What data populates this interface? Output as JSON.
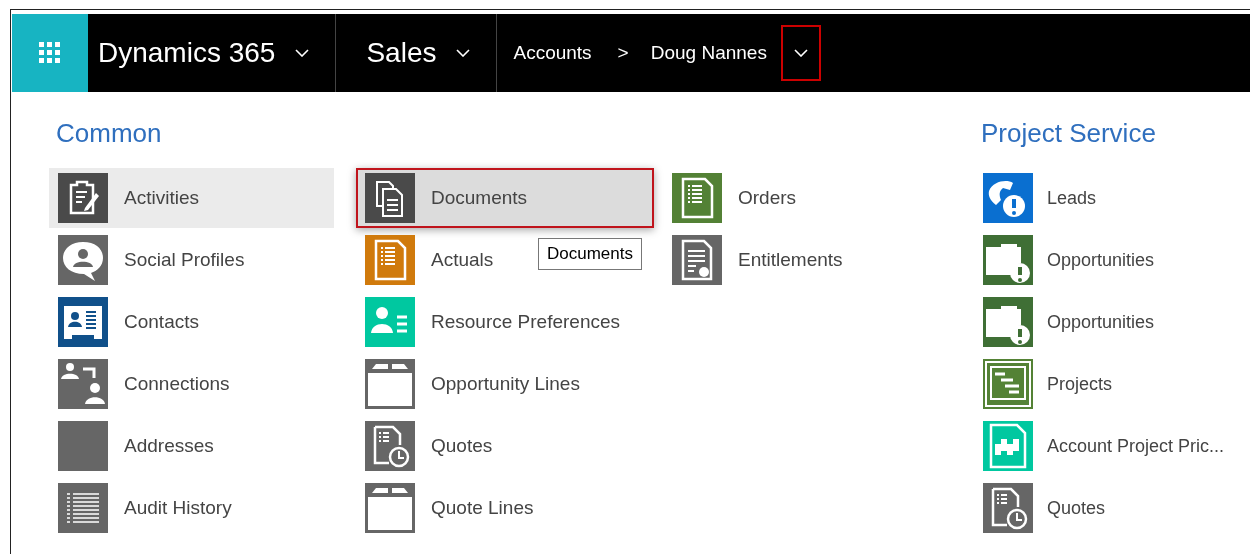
{
  "top_bar": {
    "app_title": "Dynamics 365",
    "area": "Sales",
    "breadcrumb": [
      {
        "label": "Accounts"
      },
      {
        "label": "Doug Nannes"
      }
    ],
    "separator": ">",
    "menu_caret_outlined": true
  },
  "groups": [
    {
      "title": "Common",
      "columns": [
        [
          {
            "label": "Activities",
            "kind": "clipboard",
            "color": "#4a4a4a",
            "hovered": true,
            "outlined": false
          },
          {
            "label": "Social Profiles",
            "kind": "chat-person",
            "color": "#666666",
            "hovered": false,
            "outlined": false
          },
          {
            "label": "Contacts",
            "kind": "contact-card",
            "color": "#10508a",
            "hovered": false,
            "outlined": false
          },
          {
            "label": "Connections",
            "kind": "connections",
            "color": "#666666",
            "hovered": false,
            "outlined": false
          },
          {
            "label": "Addresses",
            "kind": "blank",
            "color": "#666666",
            "hovered": false,
            "outlined": false
          },
          {
            "label": "Audit History",
            "kind": "list",
            "color": "#666666",
            "hovered": false,
            "outlined": false
          }
        ],
        [
          {
            "label": "Documents",
            "kind": "documents",
            "color": "#4a4a4a",
            "hovered": true,
            "outlined": true,
            "tooltip": "Documents"
          },
          {
            "label": "Actuals",
            "kind": "page-list",
            "color": "#d07a0c",
            "hovered": false,
            "outlined": false
          },
          {
            "label": "Resource Preferences",
            "kind": "person-list",
            "color": "#00c8a0",
            "hovered": false,
            "outlined": false
          },
          {
            "label": "Opportunity Lines",
            "kind": "window",
            "color": "#666666",
            "hovered": false,
            "outlined": false
          },
          {
            "label": "Quotes",
            "kind": "page-clock",
            "color": "#666666",
            "hovered": false,
            "outlined": false
          },
          {
            "label": "Quote Lines",
            "kind": "window",
            "color": "#666666",
            "hovered": false,
            "outlined": false
          }
        ],
        [
          {
            "label": "Orders",
            "kind": "page-list",
            "color": "#538135",
            "hovered": false,
            "outlined": false
          },
          {
            "label": "Entitlements",
            "kind": "certificate",
            "color": "#666666",
            "hovered": false,
            "outlined": false
          }
        ]
      ]
    },
    {
      "title": "Project Service",
      "columns": [
        [
          {
            "label": "Leads",
            "kind": "phone-alert",
            "color": "#0a6fd0",
            "hovered": false,
            "outlined": false
          },
          {
            "label": "Opportunities",
            "kind": "folder-alert",
            "color": "#3f6f35",
            "hovered": false,
            "outlined": false
          },
          {
            "label": "Opportunities",
            "kind": "folder-alert",
            "color": "#3f6f35",
            "hovered": false,
            "outlined": false
          },
          {
            "label": "Projects",
            "kind": "gantt",
            "color": "#548235",
            "hovered": false,
            "outlined": false
          },
          {
            "label": "Account Project Pric...",
            "kind": "puzzle-page",
            "color": "#00c8a0",
            "hovered": false,
            "outlined": false
          },
          {
            "label": "Quotes",
            "kind": "page-clock",
            "color": "#666666",
            "hovered": false,
            "outlined": false
          }
        ]
      ]
    }
  ]
}
